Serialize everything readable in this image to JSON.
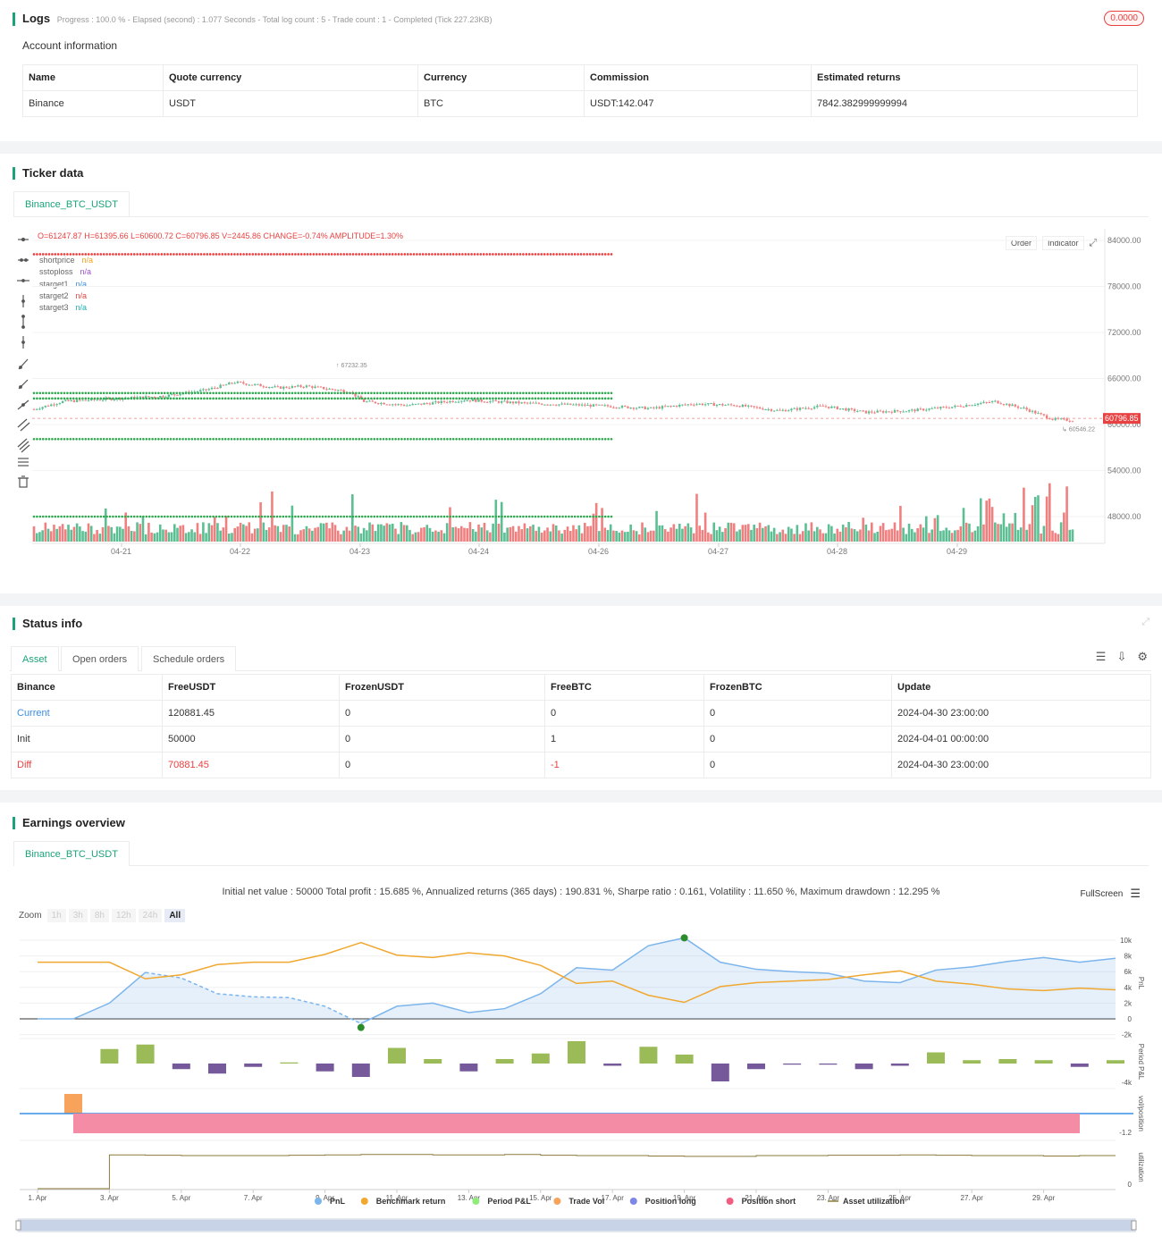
{
  "logs": {
    "title": "Logs",
    "summary": "Progress : 100.0 % - Elapsed (second) : 1.077  Seconds - Total log count : 5 - Trade count : 1 - Completed (Tick 227.23KB)",
    "badge": "0.0000"
  },
  "account": {
    "title": "Account information",
    "headers": [
      "Name",
      "Quote currency",
      "Currency",
      "Commission",
      "Estimated returns"
    ],
    "row": [
      "Binance",
      "USDT",
      "BTC",
      "USDT:142.047",
      "7842.382999999994"
    ]
  },
  "ticker": {
    "title": "Ticker data",
    "tab": "Binance_BTC_USDT",
    "ohlc": "O=61247.87 H=61395.66 L=60600.72 C=60796.85 V=2445.86 CHANGE=-0.74% AMPLITUDE=1.30%",
    "buttons": [
      "Order",
      "Indicator"
    ],
    "legend": [
      {
        "name": "shortprice",
        "value": "n/a",
        "color": "#f0a020"
      },
      {
        "name": "sstoploss",
        "value": "n/a",
        "color": "#9c4dcc"
      },
      {
        "name": "starget1",
        "value": "n/a",
        "color": "#3a8ee6"
      },
      {
        "name": "starget2",
        "value": "n/a",
        "color": "#e84141"
      },
      {
        "name": "starget3",
        "value": "n/a",
        "color": "#1ab0b0"
      }
    ],
    "y_ticks": [
      "84000.00",
      "78000.00",
      "72000.00",
      "66000.00",
      "60000.00",
      "54000.00",
      "48000.00"
    ],
    "x_ticks": [
      "04-21",
      "04-22",
      "04-23",
      "04-24",
      "04-26",
      "04-27",
      "04-28",
      "04-29"
    ],
    "price_tag": "60796.85",
    "high_note": "67232.35",
    "low_note": "60546.22"
  },
  "status": {
    "title": "Status info",
    "tabs": [
      "Asset",
      "Open orders",
      "Schedule orders"
    ],
    "headers": [
      "Binance",
      "FreeUSDT",
      "FrozenUSDT",
      "FreeBTC",
      "FrozenBTC",
      "Update"
    ],
    "rows": [
      [
        "Current",
        "120881.45",
        "0",
        "0",
        "0",
        "2024-04-30 23:00:00"
      ],
      [
        "Init",
        "50000",
        "0",
        "1",
        "0",
        "2024-04-01 00:00:00"
      ],
      [
        "Diff",
        "70881.45",
        "0",
        "-1",
        "0",
        "2024-04-30 23:00:00"
      ]
    ]
  },
  "earnings": {
    "title": "Earnings overview",
    "tab": "Binance_BTC_USDT",
    "summary": "Initial net value : 50000 Total profit : 15.685 %, Annualized returns (365 days) : 190.831 %, Sharpe ratio : 0.161, Volatility : 11.650 %, Maximum drawdown : 12.295 %",
    "fullscreen": "FullScreen",
    "zoom_label": "Zoom",
    "zoom": [
      "1h",
      "3h",
      "8h",
      "12h",
      "24h",
      "All"
    ],
    "pnl_ticks": [
      "10k",
      "8k",
      "6k",
      "4k",
      "2k",
      "0",
      "-2k"
    ],
    "period_ticks": [
      "-4k"
    ],
    "vol_ticks": [
      "-1.2"
    ],
    "util_ticks": [
      "0"
    ],
    "axis_titles": [
      "PnL",
      "Period P&L",
      "vol/position",
      "utilization"
    ],
    "x_ticks": [
      "1. Apr",
      "3. Apr",
      "5. Apr",
      "7. Apr",
      "9. Apr",
      "11. Apr",
      "13. Apr",
      "15. Apr",
      "17. Apr",
      "19. Apr",
      "21. Apr",
      "23. Apr",
      "25. Apr",
      "27. Apr",
      "29. Apr"
    ],
    "legend": [
      {
        "name": "PnL",
        "color": "#7cb5ec"
      },
      {
        "name": "Benchmark return",
        "color": "#f0a830"
      },
      {
        "name": "Period P&L",
        "color": "#90ed7d"
      },
      {
        "name": "Trade Vol",
        "color": "#f7a35c"
      },
      {
        "name": "Position long",
        "color": "#8085e9"
      },
      {
        "name": "Position short",
        "color": "#f15c80"
      },
      {
        "name": "Asset utilization",
        "color": "#8b7a3a"
      }
    ]
  },
  "colors": {
    "accent": "#1aa37a",
    "up": "#5cbf94",
    "down": "#f08080",
    "dots_red": "#ee3b3b",
    "dots_green": "#2fa84f"
  }
}
